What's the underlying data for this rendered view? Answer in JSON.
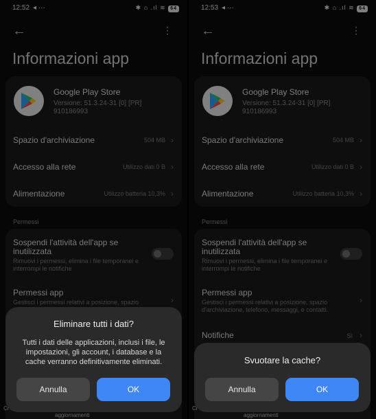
{
  "left": {
    "status": {
      "time": "12:52",
      "extra": "◂ ···",
      "icons": "✱ ⌂ .ıl ≋",
      "battery": "64"
    },
    "page_title": "Informazioni app",
    "app": {
      "name": "Google Play Store",
      "version": "Versione: 51.3.24-31 [0] [PR] 910186993"
    },
    "rows": [
      {
        "label": "Spazio d'archiviazione",
        "value": "504 MB"
      },
      {
        "label": "Accesso alla rete",
        "value": "Utilizzo dati 0 B"
      },
      {
        "label": "Alimentazione",
        "value": "Utilizzo batteria 10,3%"
      }
    ],
    "section": "Permessi",
    "perms": {
      "suspend_title": "Sospendi l'attività dell'app se inutilizzata",
      "suspend_desc": "Rimuovi i permessi, elimina i file temporanei e interrompi le notifiche",
      "perm_title": "Permessi app",
      "perm_desc": "Gestisci i permessi relativi a posizione, spazio"
    },
    "dialog": {
      "title": "Eliminare tutti i dati?",
      "body": "Tutti i dati delle applicazioni, inclusi i file, le impostazioni, gli account, i database e la cache verranno definitivamente eliminati.",
      "cancel": "Annulla",
      "ok": "OK"
    },
    "peek_left": "Cl",
    "peek_bottom": "aggiornamenti"
  },
  "right": {
    "status": {
      "time": "12:53",
      "extra": "◂ ···",
      "icons": "✱ ⌂ .ıl ≋",
      "battery": "64"
    },
    "page_title": "Informazioni app",
    "app": {
      "name": "Google Play Store",
      "version": "Versione: 51.3.24-31 [0] [PR] 910186993"
    },
    "rows": [
      {
        "label": "Spazio d'archiviazione",
        "value": "504 MB"
      },
      {
        "label": "Accesso alla rete",
        "value": "Utilizzo dati 0 B"
      },
      {
        "label": "Alimentazione",
        "value": "Utilizzo batteria 10,3%"
      }
    ],
    "section": "Permessi",
    "perms": {
      "suspend_title": "Sospendi l'attività dell'app se inutilizzata",
      "suspend_desc": "Rimuovi i permessi, elimina i file temporanei e interrompi le notifiche",
      "perm_title": "Permessi app",
      "perm_desc": "Gestisci i permessi relativi a posizione, spazio d'archiviazione, telefono, messaggi, e contatti.",
      "notif_title": "Notifiche",
      "notif_value": "Sì"
    },
    "dialog": {
      "title": "Svuotare la cache?",
      "cancel": "Annulla",
      "ok": "OK"
    },
    "peek_left": "Cl",
    "peek_bottom": "aggiornamenti"
  },
  "colors": {
    "accent": "#3f86f7",
    "dialog_bg": "#2a2a2a",
    "card_bg": "#1a1a1a"
  }
}
